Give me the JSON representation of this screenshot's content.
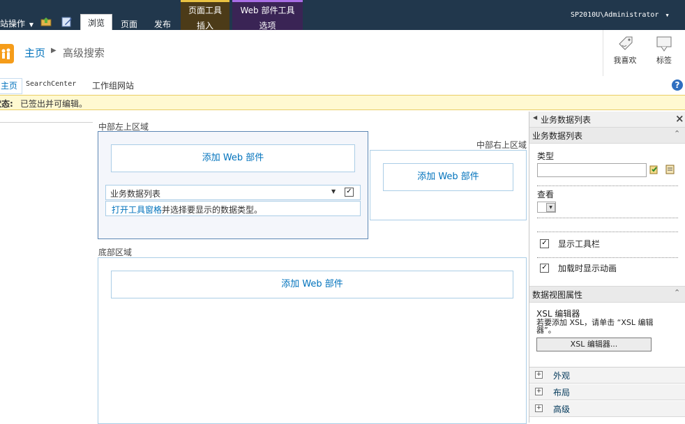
{
  "ribbon": {
    "site_actions": "网站操作",
    "tabs": [
      "浏览",
      "页面",
      "发布"
    ],
    "context_groups": [
      {
        "title": "页面工具",
        "tab": "插入"
      },
      {
        "title": "Web 部件工具",
        "tab": "选项"
      }
    ],
    "user": "SP2010U\\Administrator"
  },
  "title": {
    "home": "主页",
    "page": "高级搜索",
    "like_label": "我喜欢",
    "tags_label": "标签"
  },
  "nav": {
    "items": [
      "主页",
      "SearchCenter",
      "工作组网站"
    ]
  },
  "status": {
    "label": "状态:",
    "text": "已签出并可编辑。"
  },
  "zones": {
    "center_left_label": "中部左上区域",
    "center_right_label": "中部右上区域",
    "bottom_label": "底部区域",
    "add_web_part": "添加 Web 部件"
  },
  "webpart": {
    "title": "业务数据列表",
    "message_link": "打开工具窗格",
    "message_rest": "并选择要显示的数据类型。"
  },
  "toolpane": {
    "header": "业务数据列表",
    "section1": "业务数据列表",
    "type_label": "类型",
    "type_value": "",
    "view_label": "查看",
    "show_toolbar": "显示工具栏",
    "show_animation": "加载时显示动画",
    "section2": "数据视图属性",
    "xsl_label": "XSL 编辑器",
    "xsl_desc": "若要添加 XSL，请单击 “XSL 编辑器”。",
    "xsl_button": "XSL 编辑器...",
    "groups": [
      "外观",
      "布局",
      "高级"
    ]
  },
  "colors": {
    "ribbon_bg": "#21374c",
    "status_bg": "#fff9d1",
    "link": "#0072bc"
  }
}
